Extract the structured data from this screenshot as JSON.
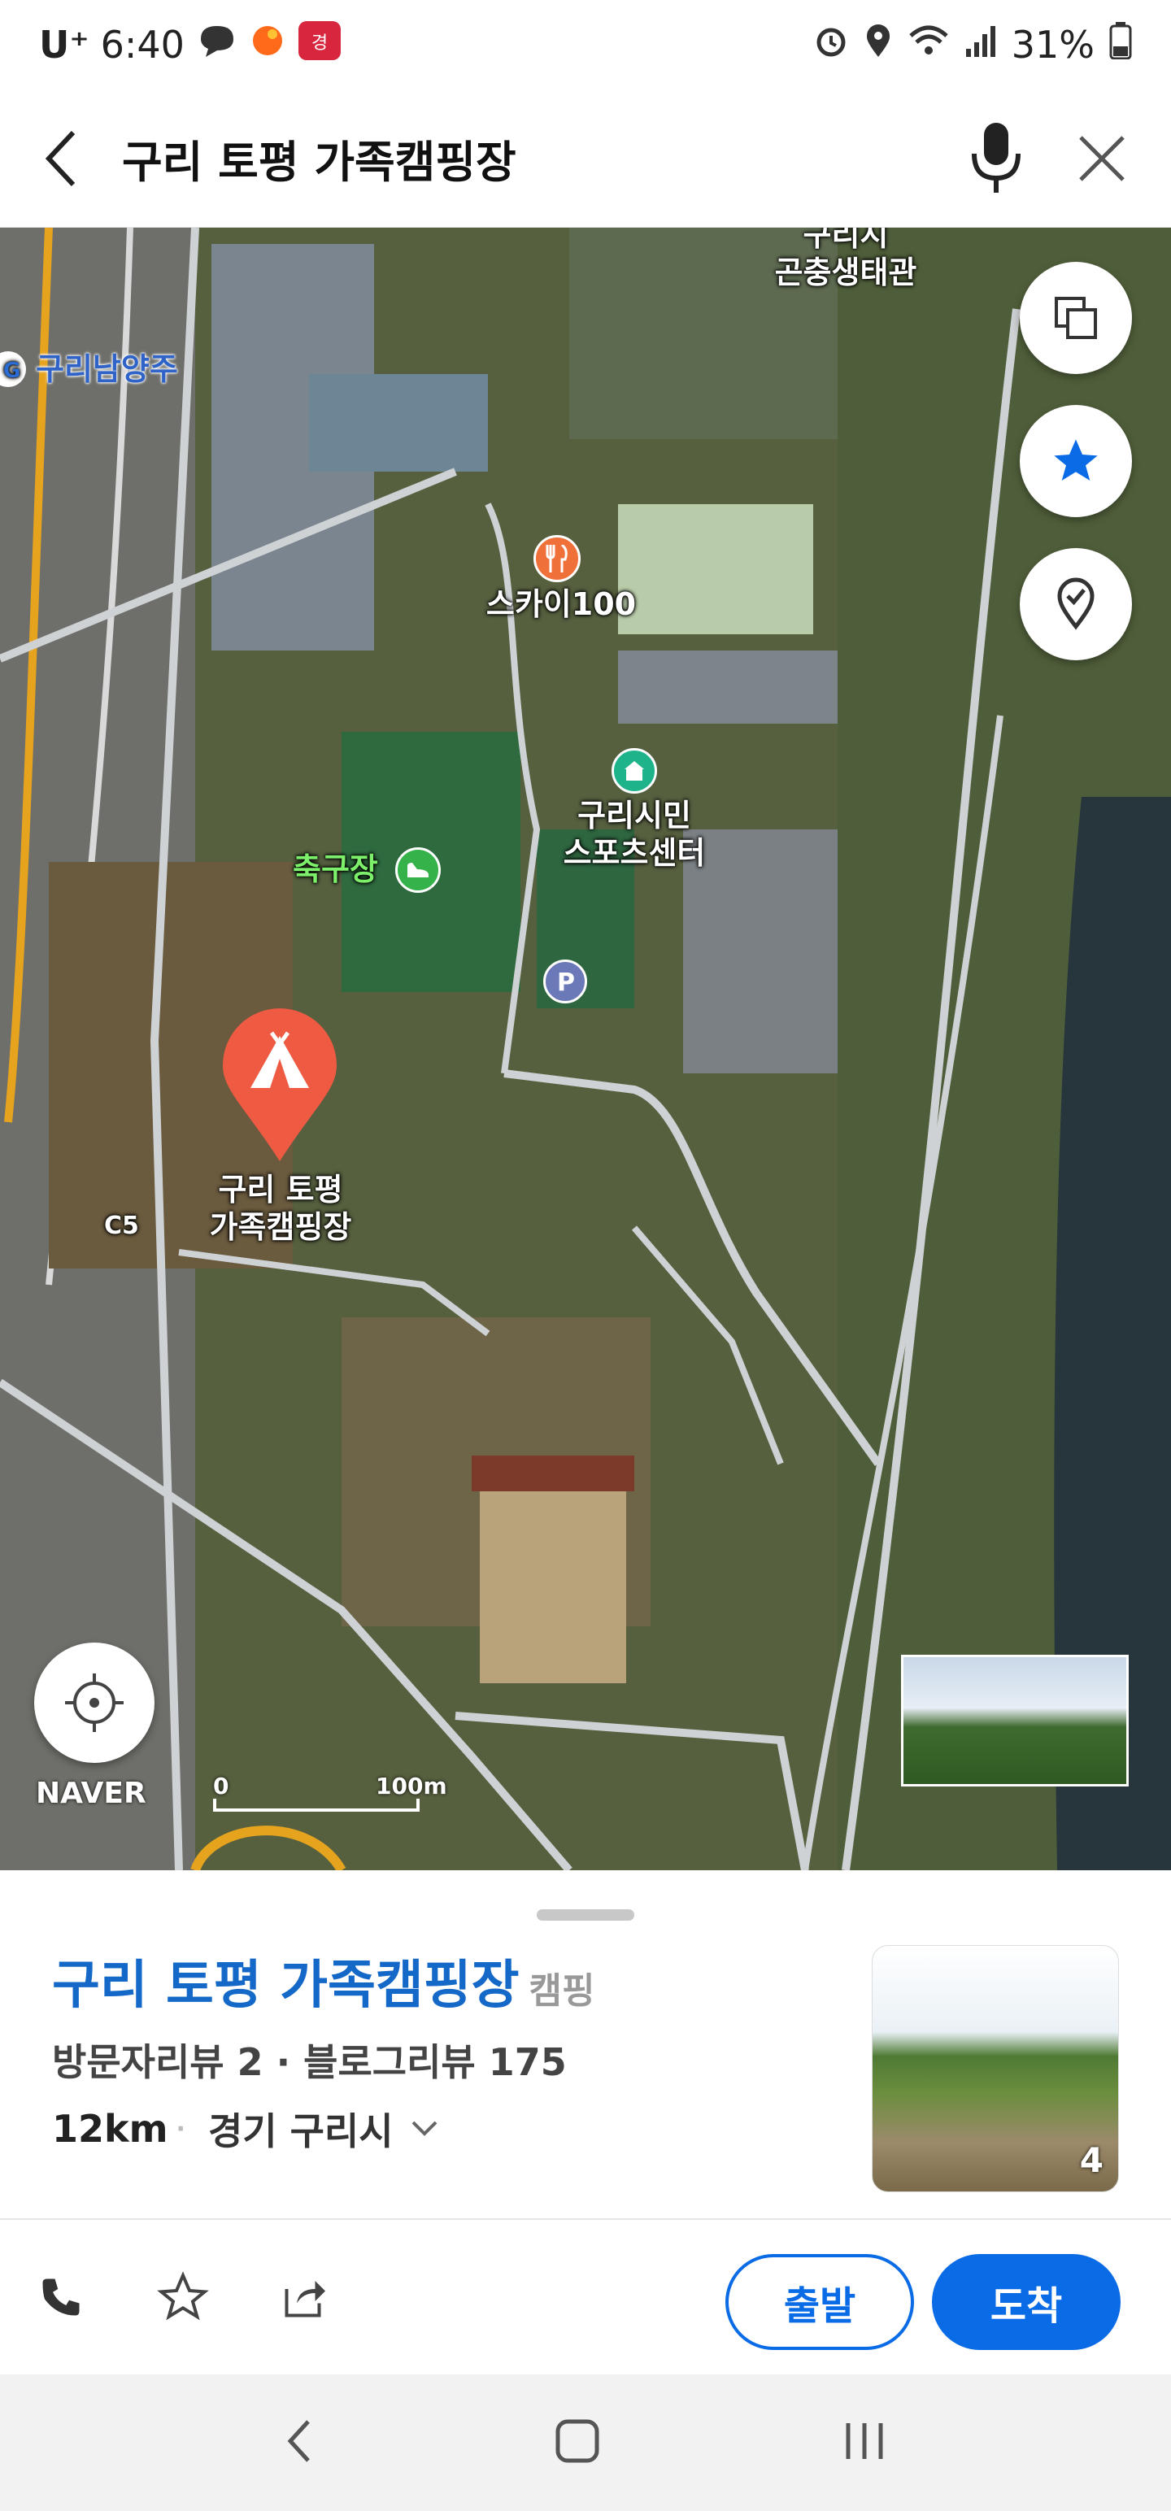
{
  "status": {
    "carrier": "U⁺",
    "time": "6:40",
    "battery": "31%"
  },
  "header": {
    "title": "구리 토평 가족캠핑장"
  },
  "map": {
    "labels": {
      "insect": "곤충생태관",
      "insect_partial": "구리시",
      "guri_namyangju": "구리남양주",
      "sky100": "스카이100",
      "sports_center": "구리시민\n스포츠센터",
      "football": "축구장",
      "campsite": "구리 토평\n가족캠핑장",
      "c5": "C5"
    },
    "naver": "NAVER",
    "scale_zero": "0",
    "scale_max": "100m"
  },
  "place": {
    "name": "구리 토평 가족캠핑장",
    "category": "캠핑",
    "reviews": "방문자리뷰 2 · 블로그리뷰 175",
    "distance": "12km",
    "address": "경기 구리시",
    "photo_count": "4"
  },
  "actions": {
    "depart": "출발",
    "arrive": "도착"
  },
  "colors": {
    "accent": "#0a6be6",
    "title_blue": "#1468c8",
    "marker": "#ef5a43"
  }
}
